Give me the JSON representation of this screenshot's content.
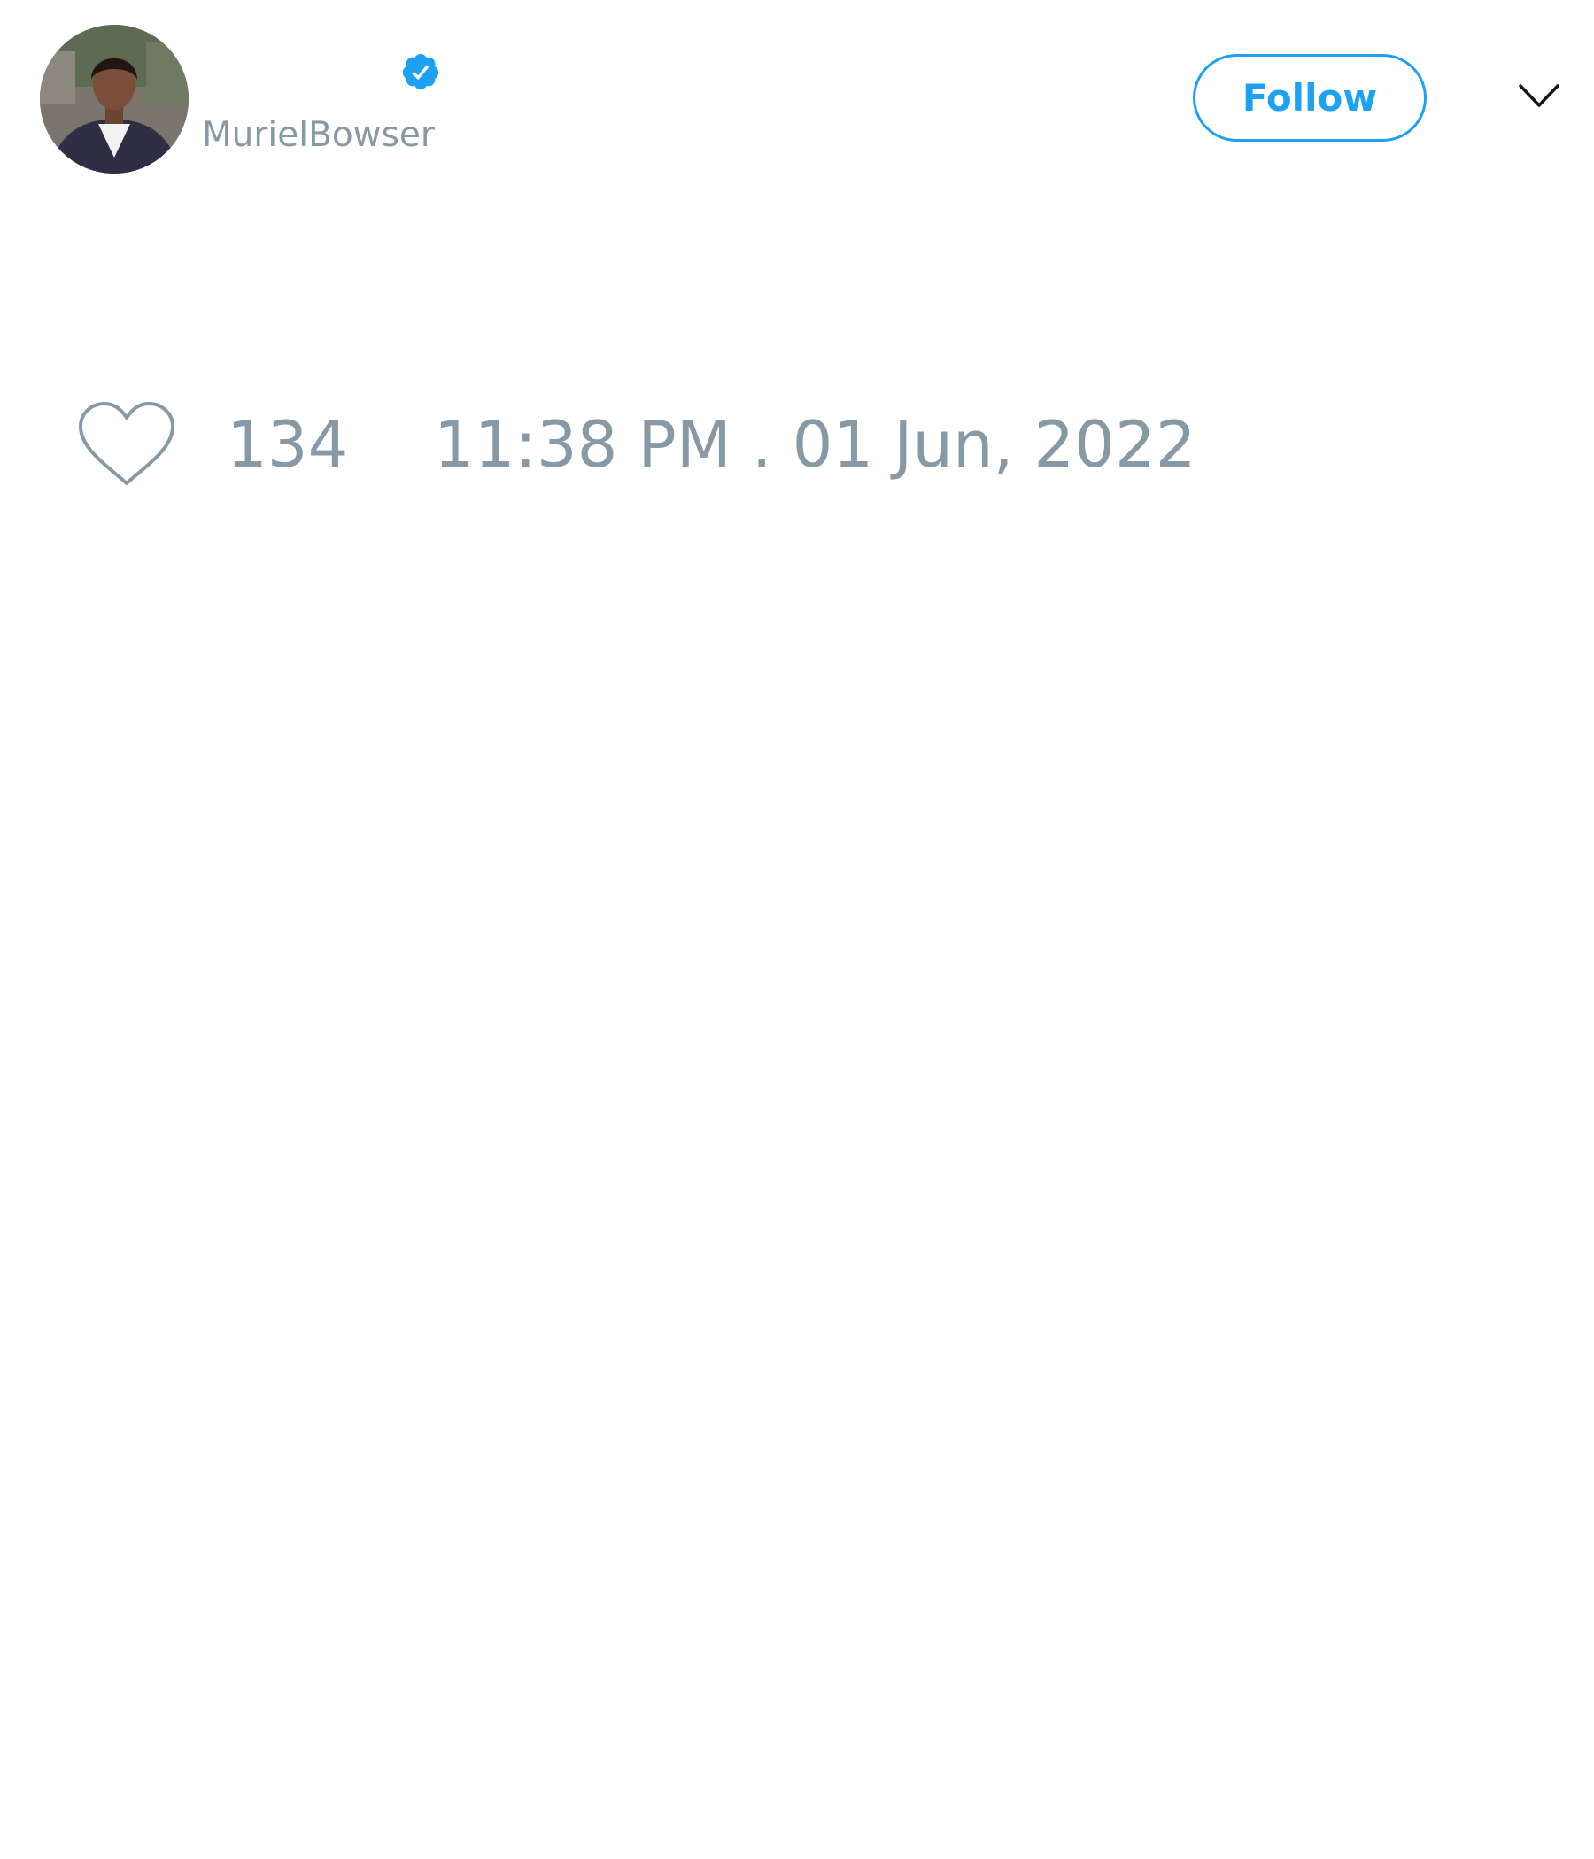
{
  "tweet": {
    "author": {
      "handle": "MurielBowser",
      "verified_color": "#1da1f2"
    },
    "follow_label": "Follow",
    "likes": "134",
    "timestamp": "11:38 PM . 01 Jun, 2022"
  },
  "icons": {
    "verified": "verified-badge-icon",
    "menu": "chevron-down-icon",
    "like": "heart-outline-icon"
  },
  "colors": {
    "accent": "#1da1f2",
    "muted_text": "#8899a6"
  }
}
